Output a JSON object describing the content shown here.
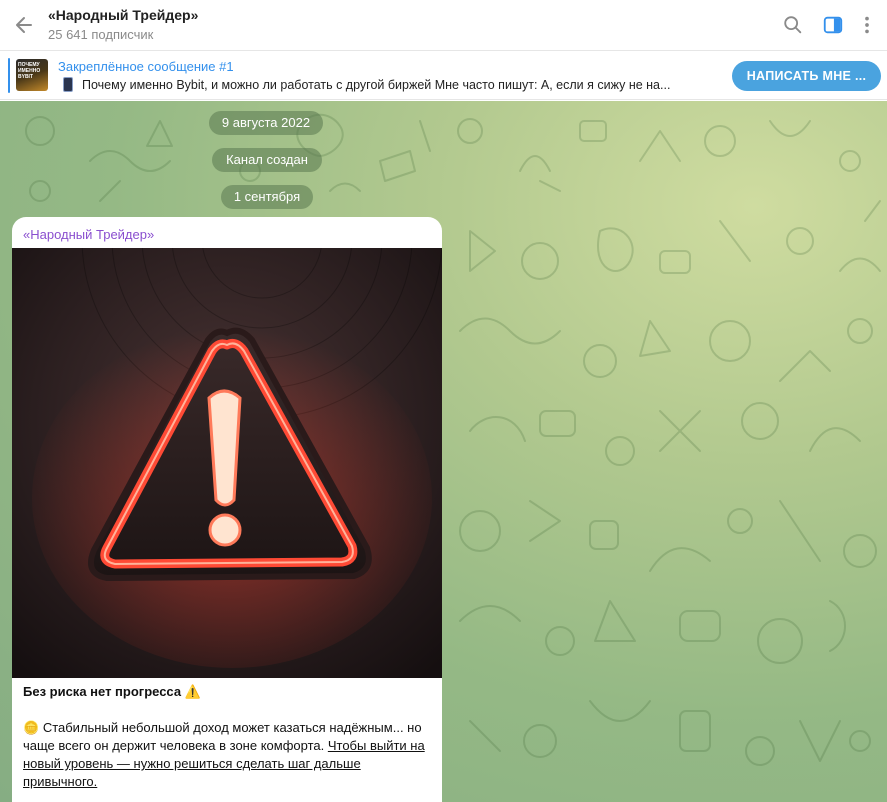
{
  "header": {
    "title": "«Народный Трейдер»",
    "subtitle": "25 641 подписчик"
  },
  "pinned": {
    "title": "Закреплённое сообщение #1",
    "thumb_text": "ПОЧЕМУ ИМЕННО BYBIT",
    "text": "Почему именно Bybit, и можно ли работать с другой биржей  Мне часто пишут:  А, если я сижу не на...",
    "button": "НАПИСАТЬ МНЕ ..."
  },
  "chat": {
    "date_1": "9 августа 2022",
    "service": "Канал создан",
    "date_2": "1 сентября"
  },
  "post": {
    "author": "«Народный Трейдер»",
    "heading": "Без риска нет прогресса",
    "heading_emoji": "⚠️",
    "body_emoji": "🪙",
    "body": "Стабильный небольшой доход может казаться надёжным... но чаще всего он держит человека в зоне комфорта.",
    "link": "Чтобы выйти на новый уровень — нужно решиться сделать шаг дальше привычного."
  },
  "colors": {
    "accent": "#3390ec",
    "author": "#8a4fcf",
    "button": "#4aa3df"
  },
  "icons": [
    "back-arrow-icon",
    "search-icon",
    "sidebar-toggle-icon",
    "more-vertical-icon",
    "warning-icon"
  ]
}
